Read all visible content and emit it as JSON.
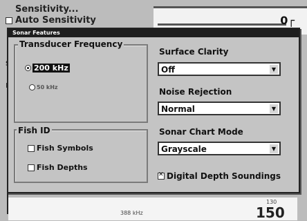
{
  "background": {
    "menu": {
      "sensitivity_label": "Sensitivity...",
      "auto_sensitivity_label": "Auto Sensitivity"
    },
    "speed_text": "388 kHz",
    "range_small": "130",
    "range_value": "150"
  },
  "dialog": {
    "title": "Sonar Features",
    "transducer": {
      "title": "Transducer Frequency",
      "options": [
        "200 kHz",
        "50 kHz"
      ]
    },
    "fish_id": {
      "title": "Fish ID",
      "symbols_label": "Fish Symbols",
      "depths_label": "Fish Depths"
    },
    "surface_clarity": {
      "label": "Surface Clarity",
      "value": "Off"
    },
    "noise_rejection": {
      "label": "Noise Rejection",
      "value": "Normal"
    },
    "sonar_chart_mode": {
      "label": "Sonar Chart Mode",
      "value": "Grayscale"
    },
    "digital_depth_label": "Digital Depth Soundings"
  }
}
